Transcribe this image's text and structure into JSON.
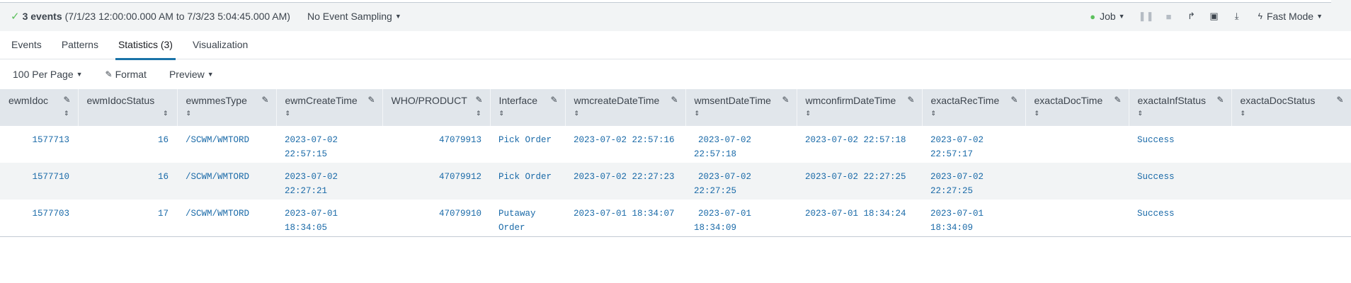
{
  "status": {
    "events_count": "3 events",
    "time_range": "(7/1/23 12:00:00.000 AM to 7/3/23 5:04:45.000 AM)",
    "sampling_label": "No Event Sampling"
  },
  "controls": {
    "job_label": "Job",
    "mode_label": "Fast Mode"
  },
  "tabs": [
    {
      "label": "Events"
    },
    {
      "label": "Patterns"
    },
    {
      "label": "Statistics (3)"
    },
    {
      "label": "Visualization"
    }
  ],
  "toolbar": {
    "per_page_label": "100 Per Page",
    "format_label": "Format",
    "preview_label": "Preview"
  },
  "columns": [
    "ewmIdoc",
    "ewmIdocStatus",
    "ewmmesType",
    "ewmCreateTime",
    "WHO/PRODUCT",
    "Interface",
    "wmcreateDateTime",
    "wmsentDateTime",
    "wmconfirmDateTime",
    "exactaRecTime",
    "exactaDocTime",
    "exactaInfStatus",
    "exactaDocStatus"
  ],
  "rows": [
    {
      "ewmIdoc": "1577713",
      "ewmIdocStatus": "16",
      "ewmmesType": "/SCWM/WMTORD",
      "ewmCreateTime": [
        "2023-07-02",
        "22:57:15"
      ],
      "who_product": "47079913",
      "interface": [
        "Pick Order"
      ],
      "wmcreateDateTime": "2023-07-02 22:57:16",
      "wmsentDateTime": [
        "2023-07-02",
        "22:57:18"
      ],
      "wmconfirmDateTime": "2023-07-02 22:57:18",
      "exactaRecTime": [
        "2023-07-02",
        "22:57:17"
      ],
      "exactaDocTime": "",
      "exactaInfStatus": "Success",
      "exactaDocStatus": ""
    },
    {
      "ewmIdoc": "1577710",
      "ewmIdocStatus": "16",
      "ewmmesType": "/SCWM/WMTORD",
      "ewmCreateTime": [
        "2023-07-02",
        "22:27:21"
      ],
      "who_product": "47079912",
      "interface": [
        "Pick Order"
      ],
      "wmcreateDateTime": "2023-07-02 22:27:23",
      "wmsentDateTime": [
        "2023-07-02",
        "22:27:25"
      ],
      "wmconfirmDateTime": "2023-07-02 22:27:25",
      "exactaRecTime": [
        "2023-07-02",
        "22:27:25"
      ],
      "exactaDocTime": "",
      "exactaInfStatus": "Success",
      "exactaDocStatus": ""
    },
    {
      "ewmIdoc": "1577703",
      "ewmIdocStatus": "17",
      "ewmmesType": "/SCWM/WMTORD",
      "ewmCreateTime": [
        "2023-07-01",
        "18:34:05"
      ],
      "who_product": "47079910",
      "interface": [
        "Putaway",
        "Order"
      ],
      "wmcreateDateTime": "2023-07-01 18:34:07",
      "wmsentDateTime": [
        "2023-07-01",
        "18:34:09"
      ],
      "wmconfirmDateTime": "2023-07-01 18:34:24",
      "exactaRecTime": [
        "2023-07-01",
        "18:34:09"
      ],
      "exactaDocTime": "",
      "exactaInfStatus": "Success",
      "exactaDocStatus": ""
    }
  ],
  "colors": {
    "accent": "#1a73a8",
    "link_text": "#1a6aa8",
    "header_bg": "#e1e6eb",
    "success_dot": "#5cc05c"
  },
  "icons": {
    "status": "check-icon",
    "job": "status-dot-icon",
    "pause": "pause-icon",
    "stop": "stop-icon",
    "share": "share-icon",
    "print": "print-icon",
    "export": "download-icon",
    "mode": "bolt-icon",
    "edit": "pencil-icon",
    "sort": "sort-icon"
  }
}
